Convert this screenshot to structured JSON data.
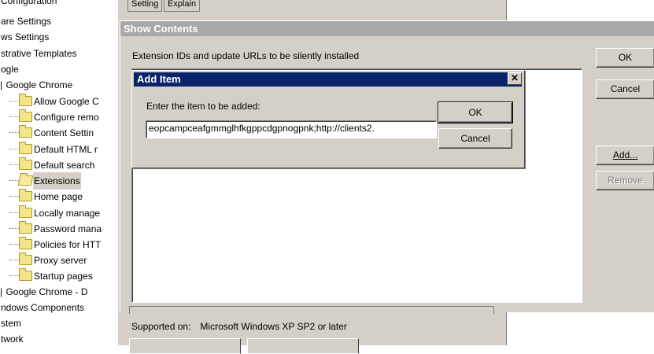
{
  "tree": {
    "items": [
      {
        "label": "Configuration",
        "indent": 0,
        "type": "text"
      },
      {
        "label": "are Settings",
        "indent": 0,
        "type": "text"
      },
      {
        "label": "ws Settings",
        "indent": 0,
        "type": "text"
      },
      {
        "label": "strative Templates",
        "indent": 0,
        "type": "text"
      },
      {
        "label": "ogle",
        "indent": 0,
        "type": "text"
      },
      {
        "label": "Google Chrome",
        "indent": 0,
        "type": "text"
      },
      {
        "label": "Allow Google C",
        "type": "folder"
      },
      {
        "label": "Configure remo",
        "type": "folder"
      },
      {
        "label": "Content Settin",
        "type": "folder"
      },
      {
        "label": "Default HTML r",
        "type": "folder"
      },
      {
        "label": "Default search",
        "type": "folder"
      },
      {
        "label": "Extensions",
        "type": "folder",
        "selected": true
      },
      {
        "label": "Home page",
        "type": "folder"
      },
      {
        "label": "Locally manage",
        "type": "folder"
      },
      {
        "label": "Password mana",
        "type": "folder"
      },
      {
        "label": "Policies for HTT",
        "type": "folder"
      },
      {
        "label": "Proxy server",
        "type": "folder"
      },
      {
        "label": "Startup pages",
        "type": "folder"
      },
      {
        "label": "Google Chrome - D",
        "indent": 0,
        "type": "text"
      },
      {
        "label": "ndows Components",
        "indent": 0,
        "type": "text"
      },
      {
        "label": "stem",
        "indent": 0,
        "type": "text"
      },
      {
        "label": "twork",
        "indent": 0,
        "type": "text"
      }
    ]
  },
  "policy_window": {
    "tabs": [
      "Setting",
      "Explain"
    ],
    "supported_label": "Supported on:",
    "supported_value": "Microsoft Windows XP SP2 or later"
  },
  "show_contents": {
    "title": "Show Contents",
    "description": "Extension IDs and update URLs to be silently installed",
    "ok_label": "OK",
    "cancel_label": "Cancel",
    "add_label": "Add...",
    "remove_label": "Remove"
  },
  "add_item": {
    "title": "Add Item",
    "close_glyph": "✕",
    "prompt": "Enter the item to be added:",
    "input_value": "eopcampceafgmmglhfkgppcdgpnogpnk;http://clients2.",
    "ok_label": "OK",
    "cancel_label": "Cancel"
  },
  "colors": {
    "dialog_face": "#d4d0c8",
    "active_title": "#0a246a",
    "inactive_title": "#a8a8a8"
  }
}
